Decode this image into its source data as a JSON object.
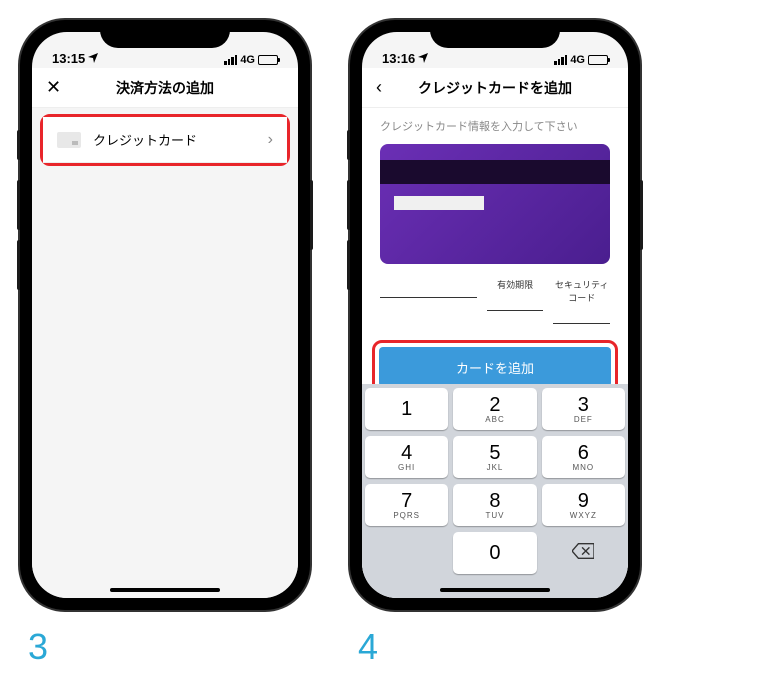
{
  "steps": {
    "step3": "3",
    "step4": "4"
  },
  "phone1": {
    "status": {
      "time": "13:15",
      "network": "4G"
    },
    "nav": {
      "title": "決済方法の追加"
    },
    "list": {
      "credit_card": "クレジットカード"
    }
  },
  "phone2": {
    "status": {
      "time": "13:16",
      "network": "4G"
    },
    "nav": {
      "title": "クレジットカードを追加"
    },
    "subtitle": "クレジットカード情報を入力して下さい",
    "fields": {
      "expiry": "有効期限",
      "cvv": "セキュリティコード"
    },
    "button": "カードを追加",
    "keypad": {
      "1": {
        "n": "1",
        "s": ""
      },
      "2": {
        "n": "2",
        "s": "ABC"
      },
      "3": {
        "n": "3",
        "s": "DEF"
      },
      "4": {
        "n": "4",
        "s": "GHI"
      },
      "5": {
        "n": "5",
        "s": "JKL"
      },
      "6": {
        "n": "6",
        "s": "MNO"
      },
      "7": {
        "n": "7",
        "s": "PQRS"
      },
      "8": {
        "n": "8",
        "s": "TUV"
      },
      "9": {
        "n": "9",
        "s": "WXYZ"
      },
      "0": {
        "n": "0",
        "s": ""
      }
    }
  }
}
